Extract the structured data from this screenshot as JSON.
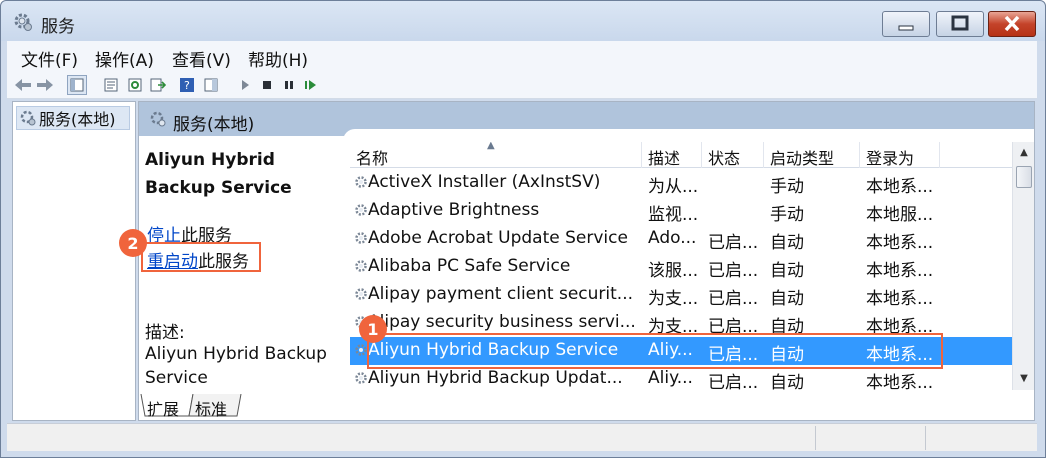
{
  "window": {
    "title": "服务"
  },
  "menubar": [
    "文件(F)",
    "操作(A)",
    "查看(V)",
    "帮助(H)"
  ],
  "tree": {
    "item": "服务(本地)"
  },
  "right_pane": {
    "header": "服务(本地)"
  },
  "detail": {
    "service_name": "Aliyun Hybrid Backup Service",
    "stop_link": "停止",
    "stop_suffix": "此服务",
    "restart_link": "重启动",
    "restart_suffix": "此服务",
    "desc_label": "描述:",
    "desc_text": "Aliyun Hybrid Backup Service"
  },
  "columns": [
    "名称",
    "描述",
    "状态",
    "启动类型",
    "登录为"
  ],
  "services": [
    {
      "name": "ActiveX Installer (AxInstSV)",
      "desc": "为从...",
      "status": "",
      "startup": "手动",
      "logon": "本地系..."
    },
    {
      "name": "Adaptive Brightness",
      "desc": "监视...",
      "status": "",
      "startup": "手动",
      "logon": "本地服..."
    },
    {
      "name": "Adobe Acrobat Update Service",
      "desc": "Ado...",
      "status": "已启...",
      "startup": "自动",
      "logon": "本地系..."
    },
    {
      "name": "Alibaba PC Safe Service",
      "desc": "该服...",
      "status": "已启...",
      "startup": "自动",
      "logon": "本地系..."
    },
    {
      "name": "Alipay payment client securit...",
      "desc": "为支...",
      "status": "已启...",
      "startup": "自动",
      "logon": "本地系..."
    },
    {
      "name": "Alipay security business servi...",
      "desc": "为支...",
      "status": "已启...",
      "startup": "自动",
      "logon": "本地系..."
    },
    {
      "name": "Aliyun Hybrid Backup Service",
      "desc": "Aliy...",
      "status": "已启...",
      "startup": "自动",
      "logon": "本地系..."
    },
    {
      "name": "Aliyun Hybrid Backup Updat...",
      "desc": "Aliy...",
      "status": "已启...",
      "startup": "自动",
      "logon": "本地系..."
    }
  ],
  "selected_service": "Aliyun Hybrid Backup Service",
  "tabs": [
    "扩展",
    "标准"
  ],
  "callouts": {
    "badge1": "1",
    "badge2": "2",
    "color": "#f0643c"
  },
  "colors": {
    "selection": "#3399ff",
    "link": "#0046c8"
  }
}
